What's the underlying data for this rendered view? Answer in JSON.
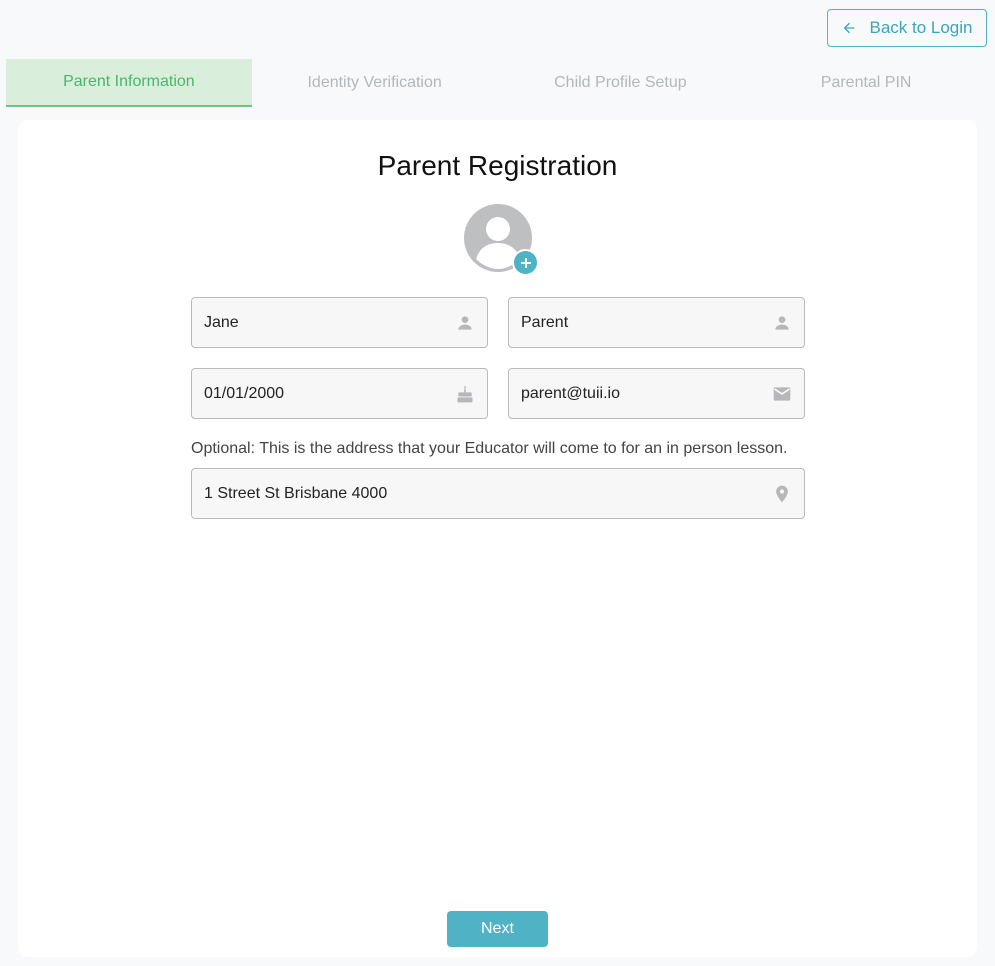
{
  "header": {
    "back_button": {
      "label": "Back to Login",
      "icon": "arrow-left-icon"
    }
  },
  "stepper": {
    "steps": [
      {
        "label": "Parent Information",
        "active": true
      },
      {
        "label": "Identity Verification",
        "active": false
      },
      {
        "label": "Child Profile Setup",
        "active": false
      },
      {
        "label": "Parental PIN",
        "active": false
      }
    ]
  },
  "form": {
    "title": "Parent Registration",
    "avatar": {
      "icon": "avatar-icon",
      "add_icon": "plus-icon"
    },
    "first_name": {
      "value": "Jane",
      "icon": "person-icon"
    },
    "last_name": {
      "value": "Parent",
      "icon": "person-icon"
    },
    "dob": {
      "value": "01/01/2000",
      "icon": "cake-icon"
    },
    "email": {
      "value": "parent@tuii.io",
      "icon": "mail-icon"
    },
    "address_helper": "Optional: This is the address that your Educator will come to for an in person lesson.",
    "address": {
      "value": "1 Street St Brisbane 4000",
      "icon": "location-pin-icon"
    },
    "next_label": "Next"
  },
  "colors": {
    "accent": "#4fb3c5",
    "step_active_bg": "#d9efdc",
    "step_active_text": "#4cb46a",
    "step_inactive_text": "#b3b7ba"
  }
}
